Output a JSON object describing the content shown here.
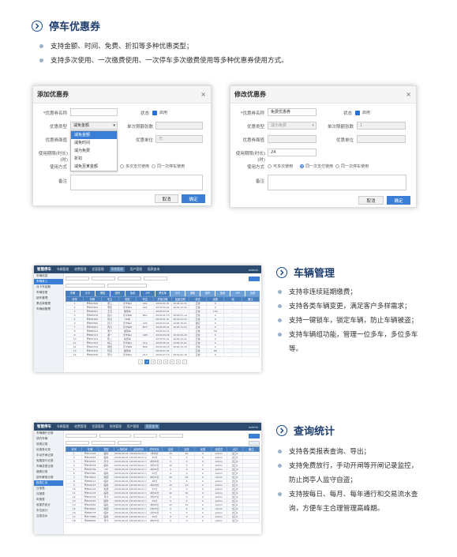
{
  "section1": {
    "title": "停车优惠券",
    "bullets": [
      "支持金额、时间、免费、折扣等多种优惠类型；",
      "支持多次使用、一次缴费使用、一次停车多次缴费使用等多种优惠券使用方式。"
    ]
  },
  "add_dialog": {
    "title": "添加优惠券",
    "close": "×",
    "name_label": "*优惠券名称",
    "status_label": "状态",
    "enabled_label": "启用",
    "type_label": "优惠类型",
    "type_value": "减免金额",
    "per_max_label": "单次限额张数",
    "denom_label": "优惠券面值",
    "unit_label": "优惠单位",
    "unit_value": "元",
    "validity_label": "使用期限(时长)(时)",
    "method_label": "使用方式",
    "method_opt3": "多次支付使用",
    "method_opt4": "同一次停车使用",
    "remark_label": "备注",
    "dropdown": [
      "减免金额",
      "减免时间",
      "减为免费",
      "折扣",
      "减免至某金额"
    ],
    "cancel": "取消",
    "ok": "确定"
  },
  "edit_dialog": {
    "title": "修改优惠券",
    "close": "×",
    "name_label": "*优惠券名称",
    "name_value": "免费优惠券",
    "status_label": "状态",
    "enabled_label": "启用",
    "type_label": "优惠类型",
    "type_value": "减为免费",
    "per_max_label": "单次限额张数",
    "per_max_value": "1",
    "denom_label": "优惠券面值",
    "unit_label": "优惠单位",
    "validity_label": "使用期限(时长)(时)",
    "validity_value": "24",
    "method_label": "使用方式",
    "method_opt1": "可多次使用",
    "method_opt2": "同一次支付使用",
    "method_opt3": "同一次停车使用",
    "remark_label": "备注",
    "cancel": "取消",
    "ok": "确定"
  },
  "section2": {
    "title": "车辆管理",
    "bullets": [
      "支持非连续延期缴费；",
      "支持各类车辆变更，满足客户多样需求；",
      "支持一键锁车，锁定车辆，防止车辆被盗；",
      "支持车辆组功能，管理一位多车，多位多车等。"
    ]
  },
  "section3": {
    "title": "查询统计",
    "bullets": [
      "支持各类报表查询、导出；",
      "支持免费放行，手动开闸等开闸记录监控，防止岗亭人监守自盗；",
      "支持按每日、每月、每年通行和交易流水查询，方便车主合理管理高峰期。"
    ]
  },
  "app1": {
    "logo": "智慧停车",
    "nav": [
      "车辆管理",
      "收费管理",
      "优惠管理",
      "系统管理",
      "用户管理",
      "报表查询"
    ],
    "nav_active": 3,
    "user": "admin",
    "side": [
      "车辆信息",
      "车辆录入",
      "月卡车延期",
      "车辆变更",
      "锁车管理",
      "黑名单管理",
      "车辆组管理"
    ],
    "side_active": 1,
    "tabs": [
      "车辆",
      "月卡",
      "储值",
      "临时",
      "免费",
      "VIP",
      "黑名单",
      "月卡",
      "储值",
      "临时",
      "免费",
      "VIP",
      "全部"
    ],
    "headers": [
      "序号",
      "车牌",
      "车主",
      "类型",
      "车位",
      "开始日期",
      "结束日期",
      "状态",
      "余额",
      "组",
      "备注"
    ],
    "rows": [
      [
        "1",
        "粤B12345",
        "张三",
        "月卡车A",
        "A01",
        "2018-01-01",
        "2018-12-31",
        "正常",
        "0",
        "-",
        ""
      ],
      [
        "2",
        "粤B23456",
        "李四",
        "月卡车A",
        "A02",
        "2018-02-01",
        "2018-12-31",
        "正常",
        "0",
        "-",
        ""
      ],
      [
        "3",
        "粤B34567",
        "王五",
        "储值车",
        "-",
        "2018-03-01",
        "-",
        "正常",
        "120",
        "-",
        ""
      ],
      [
        "4",
        "粤B45678",
        "赵六",
        "月卡车B",
        "B01",
        "2018-01-15",
        "2018-07-14",
        "正常",
        "0",
        "-",
        ""
      ],
      [
        "5",
        "粤B56789",
        "钱七",
        "VIP车",
        "-",
        "2018-01-01",
        "2019-01-01",
        "正常",
        "0",
        "-",
        ""
      ],
      [
        "6",
        "粤B67890",
        "孙八",
        "月卡车A",
        "A05",
        "2018-04-01",
        "2018-10-01",
        "锁定",
        "0",
        "-",
        ""
      ],
      [
        "7",
        "粤B78901",
        "周九",
        "月卡车B",
        "B03",
        "2018-05-01",
        "2018-11-01",
        "正常",
        "0",
        "-",
        ""
      ],
      [
        "8",
        "粤B89012",
        "吴十",
        "储值车",
        "-",
        "2018-02-11",
        "-",
        "正常",
        "56",
        "-",
        ""
      ],
      [
        "9",
        "粤B90123",
        "郑一",
        "月卡车A",
        "A08",
        "2018-03-20",
        "2018-09-20",
        "正常",
        "0",
        "-",
        ""
      ],
      [
        "10",
        "粤B01234",
        "陈二",
        "免费车",
        "-",
        "2018-01-01",
        "2018-12-31",
        "正常",
        "0",
        "-",
        ""
      ],
      [
        "11",
        "粤B11223",
        "林三",
        "月卡车A",
        "A10",
        "2018-06-01",
        "2018-12-01",
        "正常",
        "0",
        "-",
        ""
      ],
      [
        "12",
        "粤B22334",
        "黄四",
        "月卡车B",
        "B06",
        "2018-06-15",
        "2018-12-15",
        "正常",
        "0",
        "-",
        ""
      ],
      [
        "13",
        "粤B33445",
        "何五",
        "储值车",
        "-",
        "2018-07-01",
        "-",
        "正常",
        "88",
        "-",
        ""
      ],
      [
        "14",
        "粤B44556",
        "罗六",
        "月卡车A",
        "A12",
        "2018-07-10",
        "2019-01-10",
        "正常",
        "0",
        "-",
        ""
      ]
    ],
    "pages": [
      "«",
      "1",
      "2",
      "3",
      "4",
      "5",
      "6",
      "»"
    ]
  },
  "app2": {
    "logo": "智慧停车",
    "nav": [
      "车辆管理",
      "收费管理",
      "优惠管理",
      "系统管理",
      "用户管理",
      "报表查询"
    ],
    "nav_active": 5,
    "user": "admin",
    "side": [
      "车辆通行记录",
      "场内车辆",
      "收费记录",
      "优惠券记录",
      "手动开闸记录",
      "免费放行记录",
      "车辆变更记录",
      "缴费记录",
      "锁车解锁记录",
      "报表汇总",
      "日报表",
      "月报表",
      "年报表",
      "收费员统计",
      "车位统计",
      "交易流水"
    ],
    "side_active": 9,
    "headers": [
      "序号",
      "车牌",
      "类型",
      "入场时间",
      "出场时间",
      "停车时长",
      "应收",
      "实收",
      "优惠",
      "收费员",
      "出口",
      "备注"
    ],
    "rows": [
      [
        "1",
        "粤B12345",
        "临时",
        "2018-06-01 08:12",
        "2018-06-01 10:20",
        "2时8分",
        "10",
        "10",
        "0",
        "admin",
        "出口1",
        ""
      ],
      [
        "2",
        "粤B23456",
        "临时",
        "2018-06-01 08:30",
        "2018-06-01 09:05",
        "35分",
        "5",
        "5",
        "0",
        "admin",
        "出口1",
        ""
      ],
      [
        "3",
        "粤B34567",
        "月卡",
        "2018-06-01 08:41",
        "2018-06-01 18:10",
        "9时29分",
        "0",
        "0",
        "0",
        "admin",
        "出口2",
        ""
      ],
      [
        "4",
        "粤B45678",
        "临时",
        "2018-06-01 09:02",
        "2018-06-01 11:45",
        "2时43分",
        "10",
        "5",
        "5",
        "admin",
        "出口1",
        ""
      ],
      [
        "5",
        "粤B56789",
        "VIP",
        "2018-06-01 09:15",
        "2018-06-01 12:00",
        "2时45分",
        "0",
        "0",
        "0",
        "admin",
        "出口2",
        ""
      ],
      [
        "6",
        "粤B67890",
        "临时",
        "2018-06-01 09:40",
        "2018-06-01 10:02",
        "22分",
        "0",
        "0",
        "0",
        "admin",
        "出口1",
        ""
      ],
      [
        "7",
        "粤B78901",
        "储值",
        "2018-06-01 10:05",
        "2018-06-01 15:30",
        "5时25分",
        "20",
        "20",
        "0",
        "admin",
        "出口2",
        ""
      ],
      [
        "8",
        "粤B89012",
        "临时",
        "2018-06-01 10:22",
        "2018-06-01 11:10",
        "48分",
        "5",
        "5",
        "0",
        "admin",
        "出口1",
        ""
      ],
      [
        "9",
        "粤B90123",
        "临时",
        "2018-06-01 10:48",
        "2018-06-01 13:16",
        "2时28分",
        "10",
        "10",
        "0",
        "admin",
        "出口1",
        ""
      ],
      [
        "10",
        "粤B01234",
        "免费",
        "2018-06-01 11:03",
        "2018-06-01 11:40",
        "37分",
        "0",
        "0",
        "0",
        "admin",
        "出口2",
        ""
      ],
      [
        "11",
        "粤B11223",
        "临时",
        "2018-06-01 11:20",
        "2018-06-01 14:02",
        "2时42分",
        "10",
        "10",
        "0",
        "admin",
        "出口1",
        ""
      ],
      [
        "12",
        "粤B22334",
        "月卡",
        "2018-06-01 11:35",
        "2018-06-01 19:00",
        "7时25分",
        "0",
        "0",
        "0",
        "admin",
        "出口2",
        ""
      ],
      [
        "13",
        "粤B33445",
        "临时",
        "2018-06-01 12:10",
        "2018-06-01 12:55",
        "45分",
        "5",
        "5",
        "0",
        "admin",
        "出口1",
        ""
      ],
      [
        "14",
        "粤B44556",
        "临时",
        "2018-06-01 12:42",
        "2018-06-01 16:08",
        "3时26分",
        "15",
        "15",
        "0",
        "admin",
        "出口1",
        ""
      ],
      [
        "15",
        "粤B55667",
        "储值",
        "2018-06-01 13:05",
        "2018-06-01 14:30",
        "1时25分",
        "5",
        "5",
        "0",
        "admin",
        "出口2",
        ""
      ],
      [
        "16",
        "粤B66778",
        "临时",
        "2018-06-01 13:30",
        "2018-06-01 15:00",
        "1时30分",
        "5",
        "5",
        "0",
        "admin",
        "出口1",
        ""
      ],
      [
        "17",
        "粤B77889",
        "临时",
        "2018-06-01 14:00",
        "2018-06-01 14:20",
        "20分",
        "0",
        "0",
        "0",
        "admin",
        "出口1",
        ""
      ],
      [
        "18",
        "粤B88990",
        "月卡",
        "2018-06-01 14:15",
        "2018-06-01 20:40",
        "6时25分",
        "0",
        "0",
        "0",
        "admin",
        "出口2",
        ""
      ]
    ]
  }
}
